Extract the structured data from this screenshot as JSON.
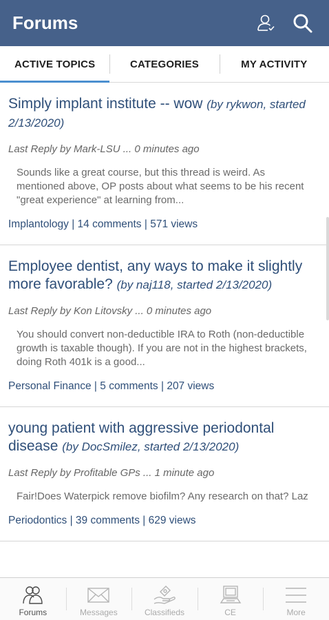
{
  "header": {
    "title": "Forums",
    "icons": [
      "user-icon",
      "search-icon"
    ]
  },
  "tabs": [
    {
      "label": "ACTIVE TOPICS",
      "active": true
    },
    {
      "label": "CATEGORIES",
      "active": false
    },
    {
      "label": "MY ACTIVITY",
      "active": false
    }
  ],
  "topics": [
    {
      "title": "Simply implant institute -- wow",
      "byline": "(by rykwon, started 2/13/2020)",
      "last_reply": "Last Reply by Mark-LSU ... 0 minutes ago",
      "excerpt": "Sounds like a great course, but this thread is weird.  As mentioned above, OP posts about what seems to be his recent \"great experience\" at learning from...",
      "meta": "Implantology  | 14 comments | 571 views"
    },
    {
      "title": "Employee dentist, any ways to make it slightly more favorable?",
      "byline": "(by naj118, started 2/13/2020)",
      "last_reply": "Last Reply by Kon Litovsky ... 0 minutes ago",
      "excerpt": "You should convert non-deductible IRA to Roth (non-deductible growth is taxable though). If you are not in the highest brackets, doing Roth 401k is a good...",
      "meta": "Personal Finance | 5 comments | 207 views"
    },
    {
      "title": "young patient with aggressive periodontal disease",
      "byline": "(by DocSmilez, started 2/13/2020)",
      "last_reply": "Last Reply by Profitable GPs ... 1 minute ago",
      "excerpt": "Fair!Does Waterpick remove biofilm? Any research on that? Laz",
      "meta": "Periodontics | 39 comments | 629 views"
    }
  ],
  "bottom_nav": [
    {
      "label": "Forums",
      "icon": "people-icon",
      "active": true
    },
    {
      "label": "Messages",
      "icon": "envelope-icon",
      "active": false
    },
    {
      "label": "Classifieds",
      "icon": "hand-money-icon",
      "active": false
    },
    {
      "label": "CE",
      "icon": "computer-icon",
      "active": false
    },
    {
      "label": "More",
      "icon": "menu-icon",
      "active": false
    }
  ],
  "colors": {
    "header_bg": "#46618a",
    "accent": "#4b8fd0",
    "link": "#2f4f79"
  }
}
